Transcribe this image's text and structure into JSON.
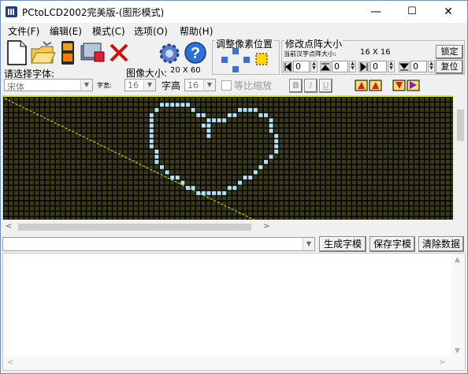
{
  "window": {
    "title": "PCtoLCD2002完美版-(图形模式)",
    "controls": {
      "minimize": "—",
      "maximize": "☐",
      "close": "✕"
    }
  },
  "menu": [
    "文件(F)",
    "编辑(E)",
    "模式(C)",
    "选项(O)",
    "帮助(H)"
  ],
  "toolbar": {
    "icons": [
      "new-icon",
      "open-icon",
      "save-icon",
      "settings-icon",
      "delete-icon",
      "gear-icon",
      "help-icon"
    ],
    "font_label": "请选择字体:",
    "font_value": "宋体",
    "char_width_label": "字宽:",
    "char_width_value": "16",
    "image_size_label": "图像大小:",
    "image_size_value": "20 X 60",
    "char_height_label": "字高",
    "char_height_value": "16",
    "proportional_label": "等比缩放",
    "bold": "B",
    "italic": "I",
    "underline": "U",
    "adjust_title": "调整像素位置",
    "dot_size_title": "修改点阵大小",
    "current_dot_size_label": "当前汉字点阵大小:",
    "current_dot_size_value": "16 X 16",
    "lock_button": "锁定",
    "reset_button": "复位",
    "spin_values": [
      "0",
      "0",
      "0",
      "0"
    ]
  },
  "canvas": {
    "grid_color": "#3a3a18",
    "pixel_color": "#aee4f8",
    "border_color": "#e6e600"
  },
  "bottom": {
    "generate_button": "生成字模",
    "save_button": "保存字模",
    "clear_button": "清除数据"
  }
}
